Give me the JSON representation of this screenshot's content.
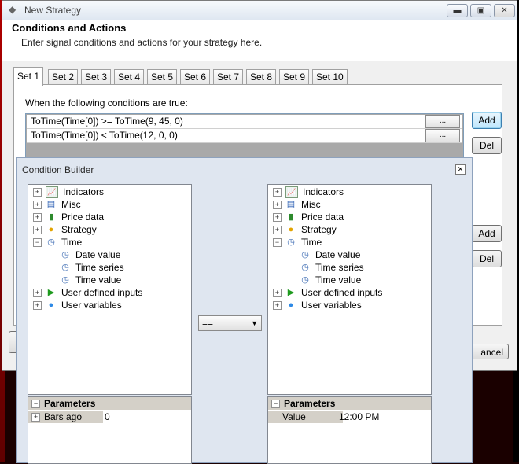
{
  "window": {
    "title": "New Strategy",
    "header_title": "Conditions and Actions",
    "header_subtitle": "Enter signal conditions and actions for your strategy here."
  },
  "tabs": [
    "Set 1",
    "Set 2",
    "Set 3",
    "Set 4",
    "Set 5",
    "Set 6",
    "Set 7",
    "Set 8",
    "Set 9",
    "Set 10"
  ],
  "conditions": {
    "label": "When the following conditions are true:",
    "rows": [
      "ToTime(Time[0]) >= ToTime(9, 45, 0)",
      "ToTime(Time[0]) < ToTime(12, 0, 0)"
    ],
    "dots_label": "...",
    "add_label": "Add",
    "del_label": "Del"
  },
  "actions": {
    "add_label": "Add",
    "del_label": "Del"
  },
  "cancel_label": "ancel",
  "builder": {
    "title": "Condition Builder",
    "operator": "==",
    "left_tree": {
      "items": [
        {
          "label": "Indicators",
          "icon": "indicators-icon",
          "pm": "+"
        },
        {
          "label": "Misc",
          "icon": "misc-icon",
          "pm": "+"
        },
        {
          "label": "Price data",
          "icon": "price-data-icon",
          "pm": "+"
        },
        {
          "label": "Strategy",
          "icon": "strategy-icon",
          "pm": "+"
        },
        {
          "label": "Time",
          "icon": "time-icon",
          "pm": "−"
        },
        {
          "label": "Date value",
          "icon": "time-item-icon",
          "child": true
        },
        {
          "label": "Time series",
          "icon": "time-item-icon",
          "child": true
        },
        {
          "label": "Time value",
          "icon": "time-item-icon",
          "child": true
        },
        {
          "label": "User defined inputs",
          "icon": "play-icon",
          "pm": "+"
        },
        {
          "label": "User variables",
          "icon": "globe-icon",
          "pm": "+"
        }
      ],
      "params_title": "Parameters",
      "param_name": "Bars ago",
      "param_value": "0"
    },
    "right_tree": {
      "items": [
        {
          "label": "Indicators",
          "icon": "indicators-icon",
          "pm": "+"
        },
        {
          "label": "Misc",
          "icon": "misc-icon",
          "pm": "+"
        },
        {
          "label": "Price data",
          "icon": "price-data-icon",
          "pm": "+"
        },
        {
          "label": "Strategy",
          "icon": "strategy-icon",
          "pm": "+"
        },
        {
          "label": "Time",
          "icon": "time-icon",
          "pm": "−"
        },
        {
          "label": "Date value",
          "icon": "time-item-icon",
          "child": true
        },
        {
          "label": "Time series",
          "icon": "time-item-icon",
          "child": true
        },
        {
          "label": "Time value",
          "icon": "time-item-icon",
          "child": true
        },
        {
          "label": "User defined inputs",
          "icon": "play-icon",
          "pm": "+"
        },
        {
          "label": "User variables",
          "icon": "globe-icon",
          "pm": "+"
        }
      ],
      "params_title": "Parameters",
      "param_name": "Value",
      "param_value": "12:00 PM"
    }
  }
}
